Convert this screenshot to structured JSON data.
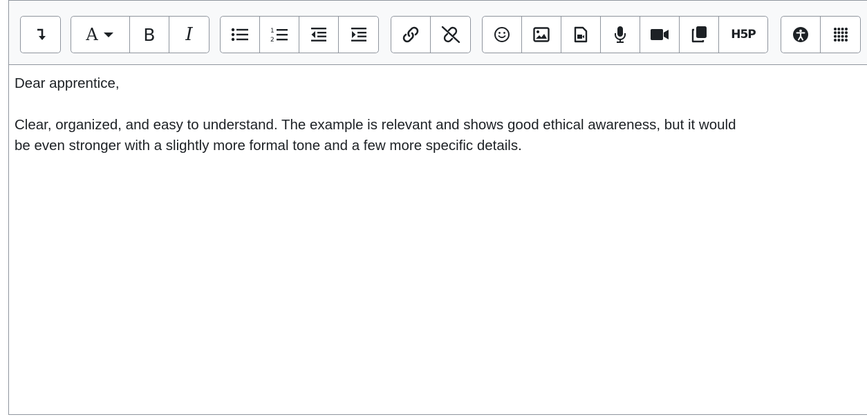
{
  "toolbar": {
    "groups": [
      {
        "buttons": [
          {
            "icon": "collapse-icon"
          }
        ]
      },
      {
        "buttons": [
          {
            "icon": "font-color-icon",
            "label": "A"
          },
          {
            "icon": "bold-icon",
            "label": "B"
          },
          {
            "icon": "italic-icon",
            "label": "I"
          }
        ]
      },
      {
        "buttons": [
          {
            "icon": "unordered-list-icon"
          },
          {
            "icon": "ordered-list-icon"
          },
          {
            "icon": "outdent-icon"
          },
          {
            "icon": "indent-icon"
          }
        ]
      },
      {
        "buttons": [
          {
            "icon": "link-icon"
          },
          {
            "icon": "unlink-icon"
          }
        ]
      },
      {
        "buttons": [
          {
            "icon": "emoji-icon"
          },
          {
            "icon": "image-icon"
          },
          {
            "icon": "media-file-icon"
          },
          {
            "icon": "microphone-icon"
          },
          {
            "icon": "video-camera-icon"
          },
          {
            "icon": "copy-icon"
          },
          {
            "icon": "h5p-icon",
            "label": "H5P"
          }
        ]
      },
      {
        "buttons": [
          {
            "icon": "accessibility-icon"
          },
          {
            "icon": "more-apps-icon"
          }
        ]
      }
    ]
  },
  "content": {
    "greeting": "Dear apprentice,",
    "line1": "Clear, organized, and easy to understand. The example is relevant and shows good ethical awareness, but it would",
    "line2": "be even stronger with a slightly more formal tone and a few more specific details."
  }
}
